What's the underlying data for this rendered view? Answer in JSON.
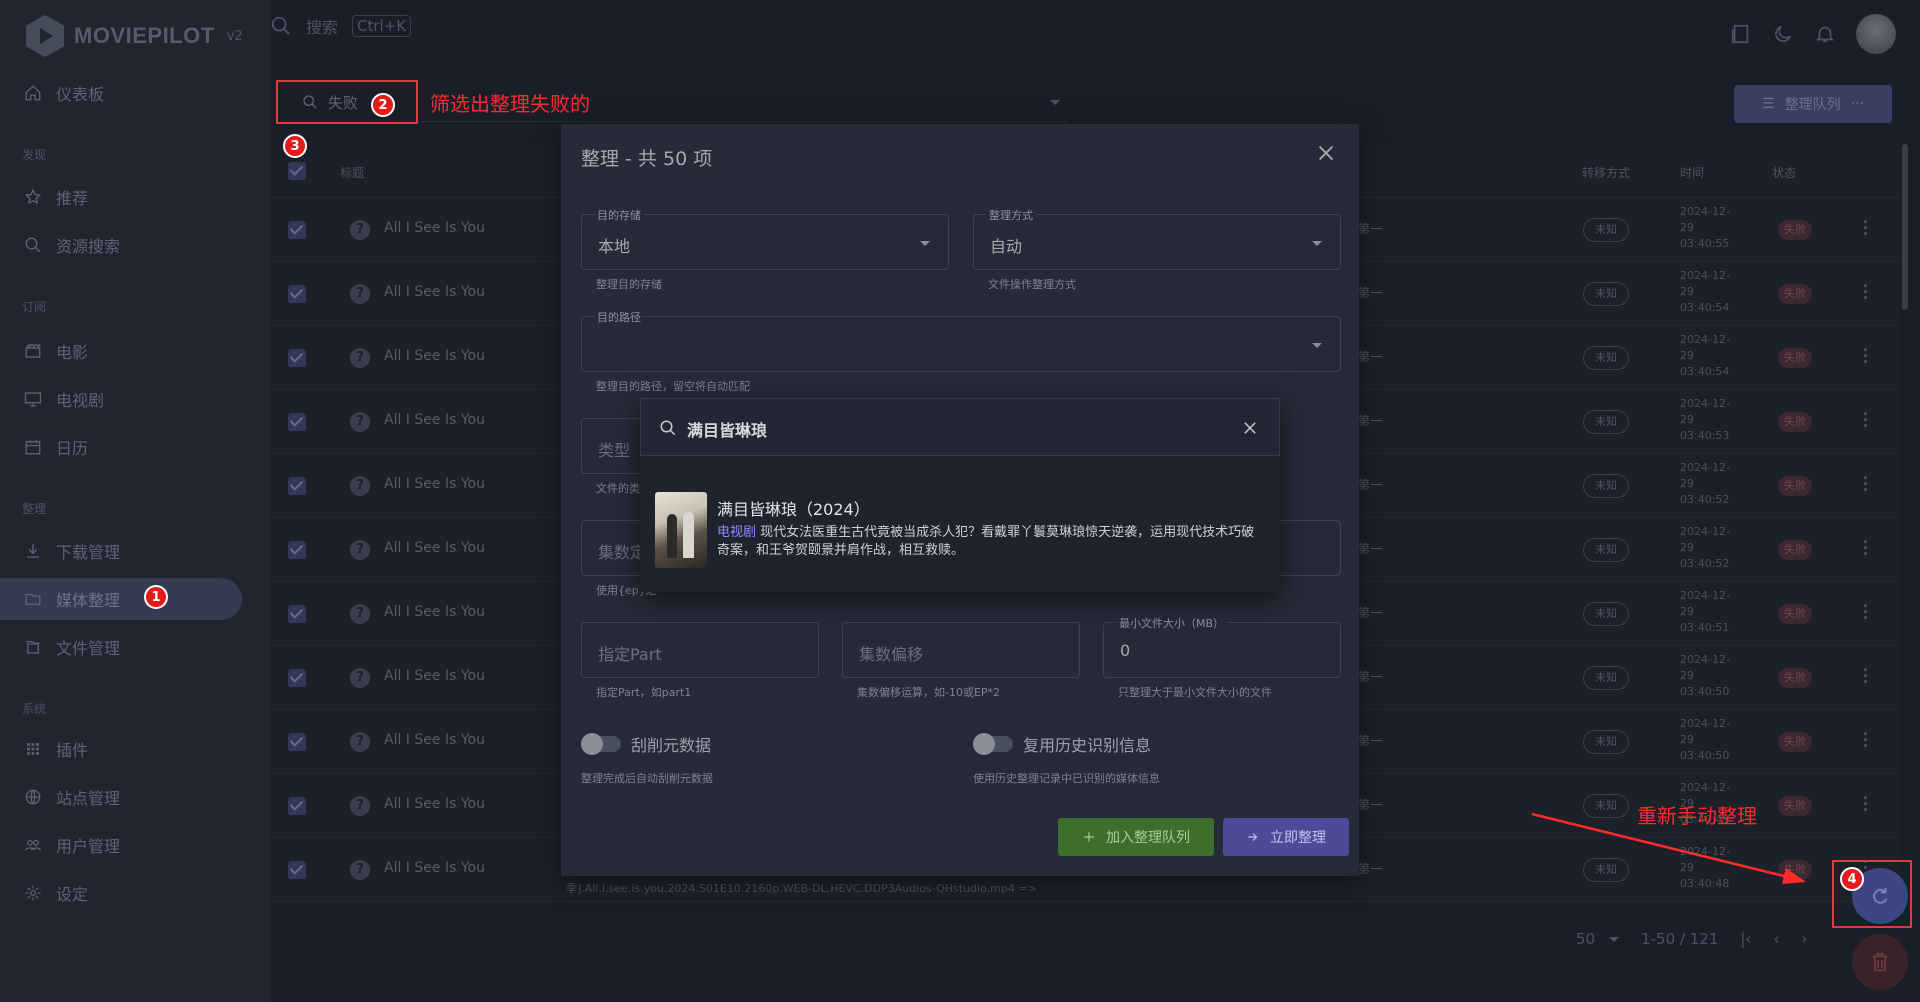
{
  "app": {
    "name": "MOVIEPILOT",
    "version": "v2"
  },
  "topbar": {
    "search_placeholder": "搜索",
    "shortcut": "Ctrl+K"
  },
  "sidebar": {
    "sections": [
      {
        "label": "发现"
      },
      {
        "label": "订阅"
      },
      {
        "label": "整理"
      },
      {
        "label": "系统"
      }
    ],
    "items": [
      {
        "label": "仪表板",
        "icon": "home-icon"
      },
      {
        "label": "推荐",
        "icon": "star-icon"
      },
      {
        "label": "资源搜索",
        "icon": "search-icon"
      },
      {
        "label": "电影",
        "icon": "movie-icon"
      },
      {
        "label": "电视剧",
        "icon": "tv-icon"
      },
      {
        "label": "日历",
        "icon": "calendar-icon"
      },
      {
        "label": "下载管理",
        "icon": "download-icon"
      },
      {
        "label": "媒体整理",
        "icon": "folder-icon",
        "active": true
      },
      {
        "label": "文件管理",
        "icon": "files-icon"
      },
      {
        "label": "插件",
        "icon": "grid-icon"
      },
      {
        "label": "站点管理",
        "icon": "globe-icon"
      },
      {
        "label": "用户管理",
        "icon": "users-icon"
      },
      {
        "label": "设定",
        "icon": "gear-icon"
      }
    ]
  },
  "filter": {
    "value": "失败"
  },
  "annotations": {
    "filter_note": "筛选出整理失败的",
    "retry_note": "重新手动整理",
    "badges": [
      "1",
      "2",
      "3",
      "4"
    ]
  },
  "queue_button": {
    "label": "整理队列"
  },
  "table": {
    "headers": {
      "title": "标题",
      "transfer": "转移方式",
      "time": "时间",
      "status": "状态"
    },
    "rows": [
      {
        "title": "All I See Is You",
        "ep": "第一",
        "mode": "未知",
        "time": "2024-12-29 03:40:55",
        "status": "失败"
      },
      {
        "title": "All I See Is You",
        "ep": "第一",
        "mode": "未知",
        "time": "2024-12-29 03:40:54",
        "status": "失败"
      },
      {
        "title": "All I See Is You",
        "ep": "第一",
        "mode": "未知",
        "time": "2024-12-29 03:40:54",
        "status": "失败"
      },
      {
        "title": "All I See Is You",
        "ep": "第一",
        "mode": "未知",
        "time": "2024-12-29 03:40:53",
        "status": "失败"
      },
      {
        "title": "All I See Is You",
        "ep": "第一",
        "mode": "未知",
        "time": "2024-12-29 03:40:52",
        "status": "失败"
      },
      {
        "title": "All I See Is You",
        "ep": "第一",
        "mode": "未知",
        "time": "2024-12-29 03:40:52",
        "status": "失败"
      },
      {
        "title": "All I See Is You",
        "ep": "第一",
        "mode": "未知",
        "time": "2024-12-29 03:40:51",
        "status": "失败"
      },
      {
        "title": "All I See Is You",
        "ep": "第一",
        "mode": "未知",
        "time": "2024-12-29 03:40:50",
        "status": "失败"
      },
      {
        "title": "All I See Is You",
        "ep": "第一",
        "mode": "未知",
        "time": "2024-12-29 03:40:50",
        "status": "失败"
      },
      {
        "title": "All I See Is You",
        "ep": "第一",
        "mode": "未知",
        "time": "2024-12-29 03:40:49",
        "status": "失败"
      },
      {
        "title": "All I See Is You",
        "ep": "第一",
        "mode": "未知",
        "time": "2024-12-29 03:40:48",
        "status": "失败"
      }
    ]
  },
  "pagination": {
    "per_page": "50",
    "range": "1-50 / 121"
  },
  "modal": {
    "title": "整理 - 共 50 项",
    "target_storage": {
      "label": "目的存储",
      "value": "本地",
      "hint": "整理目的存储"
    },
    "transfer_mode": {
      "label": "整理方式",
      "value": "自动",
      "hint": "文件操作整理方式"
    },
    "target_path": {
      "label": "目的路径",
      "value": "",
      "hint": "整理目的路径，留空将自动匹配"
    },
    "type": {
      "placeholder": "类型",
      "hint": "文件的类"
    },
    "episode_locate": {
      "placeholder": "集数定",
      "hint": "使用{ep}定"
    },
    "part": {
      "placeholder": "指定Part",
      "hint": "指定Part，如part1"
    },
    "episode_offset": {
      "placeholder": "集数偏移",
      "hint": "集数偏移运算，如-10或EP*2"
    },
    "min_size": {
      "label": "最小文件大小（MB）",
      "value": "0",
      "hint": "只整理大于最小文件大小的文件"
    },
    "scrape": {
      "label": "刮削元数据",
      "hint": "整理完成后自动刮削元数据"
    },
    "history": {
      "label": "复用历史识别信息",
      "hint": "使用历史整理记录中已识别的媒体信息"
    },
    "add_queue": "加入整理队列",
    "transfer_now": "立即整理"
  },
  "file_path": "季].All.I.see.is.you.2024.S01E10.2160p.WEB-DL.HEVC.DDP3Audios-QHstudio.mp4 =>",
  "search_popup": {
    "query": "满目皆琳琅",
    "result": {
      "title": "满目皆琳琅（2024）",
      "type": "电视剧",
      "description": "现代女法医重生古代竟被当成杀人犯？看戴罪丫鬟莫琳琅惊天逆袭，运用现代技术巧破奇案，和王爷贺颐景并肩作战，相互救赎。"
    }
  },
  "colors": {
    "accent": "#7367f0",
    "annotation": "#ff2a2a",
    "success": "#3d6e2b"
  }
}
